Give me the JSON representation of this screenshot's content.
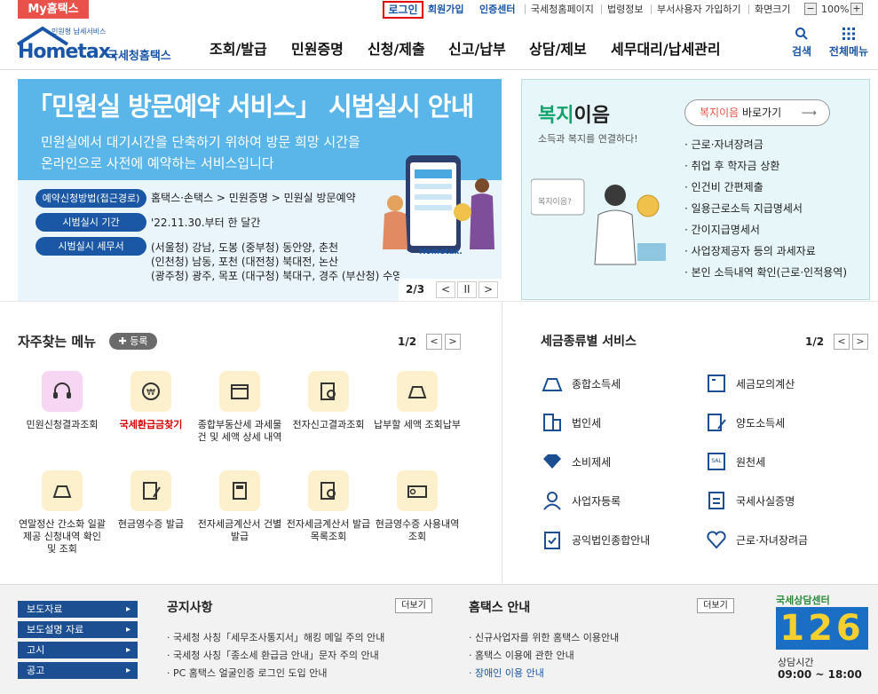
{
  "topbar": {
    "my_hometax": "My홈택스",
    "login": "로그인",
    "signup": "회원가입",
    "cert_center": "인증센터",
    "nts_home": "국세청홈페이지",
    "law_info": "법령정보",
    "dept_join": "부서사용자 가입하기",
    "screen_size": "화면크기",
    "zoom": "100%"
  },
  "header": {
    "logo_small": "민원형 납세서비스",
    "logo_main": "Hometax.",
    "logo_text": "국세청홈택스",
    "gnb": [
      "조회/발급",
      "민원증명",
      "신청/제출",
      "신고/납부",
      "상담/제보",
      "세무대리/납세관리"
    ],
    "search": "검색",
    "all_menu": "전체메뉴"
  },
  "banner": {
    "title": "「민원실 방문예약 서비스」 시범실시 안내",
    "sub1": "민원실에서 대기시간을 단축하기 위하여 방문 희망 시간을",
    "sub2": "온라인으로 사전에 예약하는 서비스입니다",
    "row1_label": "예약신청방법(접근경로)",
    "row1_text": "홈택스·손택스 > 민원증명 > 민원실 방문예약",
    "row2_label": "시범실시 기간",
    "row2_text": "'22.11.30.부터 한 달간",
    "row3_label": "시범실시 세무서",
    "row3_lines": [
      "(서울청) 강남, 도봉 (중부청) 동안양, 춘천",
      "(인천청) 남동, 포천 (대전청) 북대전, 논산",
      "(광주청) 광주, 목포 (대구청) 북대구, 경주 (부산청) 수영, 마산"
    ],
    "phone_logo": "Hometax.",
    "pager": "2/3",
    "prev": "<",
    "pause": "II",
    "next": ">"
  },
  "welfare": {
    "title_a": "복지",
    "title_b": "이음",
    "subtitle": "소득과 복지를 연결하다!",
    "btn_a": "복지이음",
    "btn_b": " 바로가기",
    "items": [
      "근로·자녀장려금",
      "취업 후 학자금 상환",
      "인건비 간편제출",
      "일용근로소득 지급명세서",
      "간이지급명세서",
      "사업장제공자 등의 과세자료",
      "본인 소득내역 확인(근로·인적용역)"
    ],
    "bubble": "복지이음?"
  },
  "freq": {
    "title": "자주찾는 메뉴",
    "add": "등록",
    "pager": "1/2",
    "prev": "<",
    "next": ">",
    "items": [
      {
        "label": "민원신청결과조회"
      },
      {
        "label": "국세환급금찾기"
      },
      {
        "label": "종합부동산세 과세물건 및 세액 상세 내역"
      },
      {
        "label": "전자신고결과조회"
      },
      {
        "label": "납부할 세액 조회납부"
      },
      {
        "label": "연말정산 간소화 일괄제공 신청내역 확인 및 조회"
      },
      {
        "label": "현금영수증 발급"
      },
      {
        "label": "전자세금계산서 건별발급"
      },
      {
        "label": "전자세금계산서 발급목록조회"
      },
      {
        "label": "현금영수증 사용내역조회"
      }
    ]
  },
  "taxtype": {
    "title": "세금종류별 서비스",
    "pager": "1/2",
    "prev": "<",
    "next": ">",
    "items": [
      "종합소득세",
      "세금모의계산",
      "법인세",
      "양도소득세",
      "소비제세",
      "원천세",
      "사업자등록",
      "국세사실증명",
      "공익법인종합안내",
      "근로·자녀장려금"
    ]
  },
  "footer": {
    "buttons": [
      "보도자료",
      "보도설명 자료",
      "고시",
      "공고"
    ],
    "notice_title": "공지사항",
    "notice_more": "더보기",
    "notices": [
      "국세청 사칭「세무조사통지서」해킹 메일 주의 안내",
      "국세청 사칭「종소세 환급금 안내」문자 주의 안내",
      "PC 홈택스 얼굴인증 로그인 도입 안내"
    ],
    "guide_title": "홈택스 안내",
    "guide_more": "더보기",
    "guides": [
      "신규사업자를 위한 홈택스 이용안내",
      "홈택스 이용에 관한 안내",
      "장애인 이용 안내"
    ],
    "call_label": "국세상담센터",
    "call_number": "126",
    "hours_label": "상담시간",
    "hours": "09:00 ~ 18:00"
  }
}
